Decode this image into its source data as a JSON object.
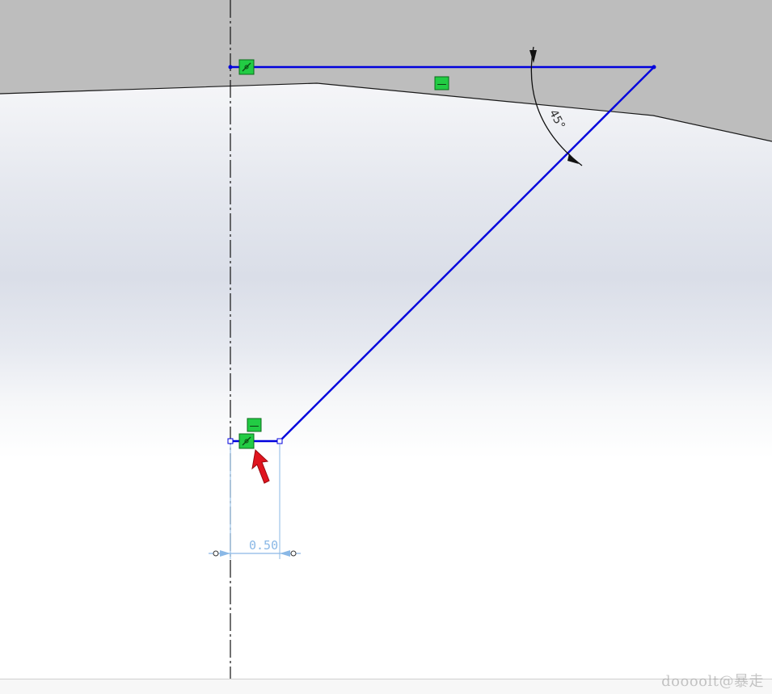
{
  "sketch": {
    "angle_dimension": {
      "value_text": "45°"
    },
    "linear_dimension": {
      "value_text": "0.50"
    },
    "relations": {
      "top_horizontal": "—",
      "bottom_horizontal": "—"
    },
    "colors": {
      "model_face": "#bdbdbd",
      "sketch_line": "#0000dd",
      "centerline": "#111111",
      "relation_badge": "#22cc44",
      "dimension": "#8ab8e6",
      "cursor_arrow": "#e0141e"
    }
  },
  "watermark": {
    "text": "doooolt@暴走"
  }
}
